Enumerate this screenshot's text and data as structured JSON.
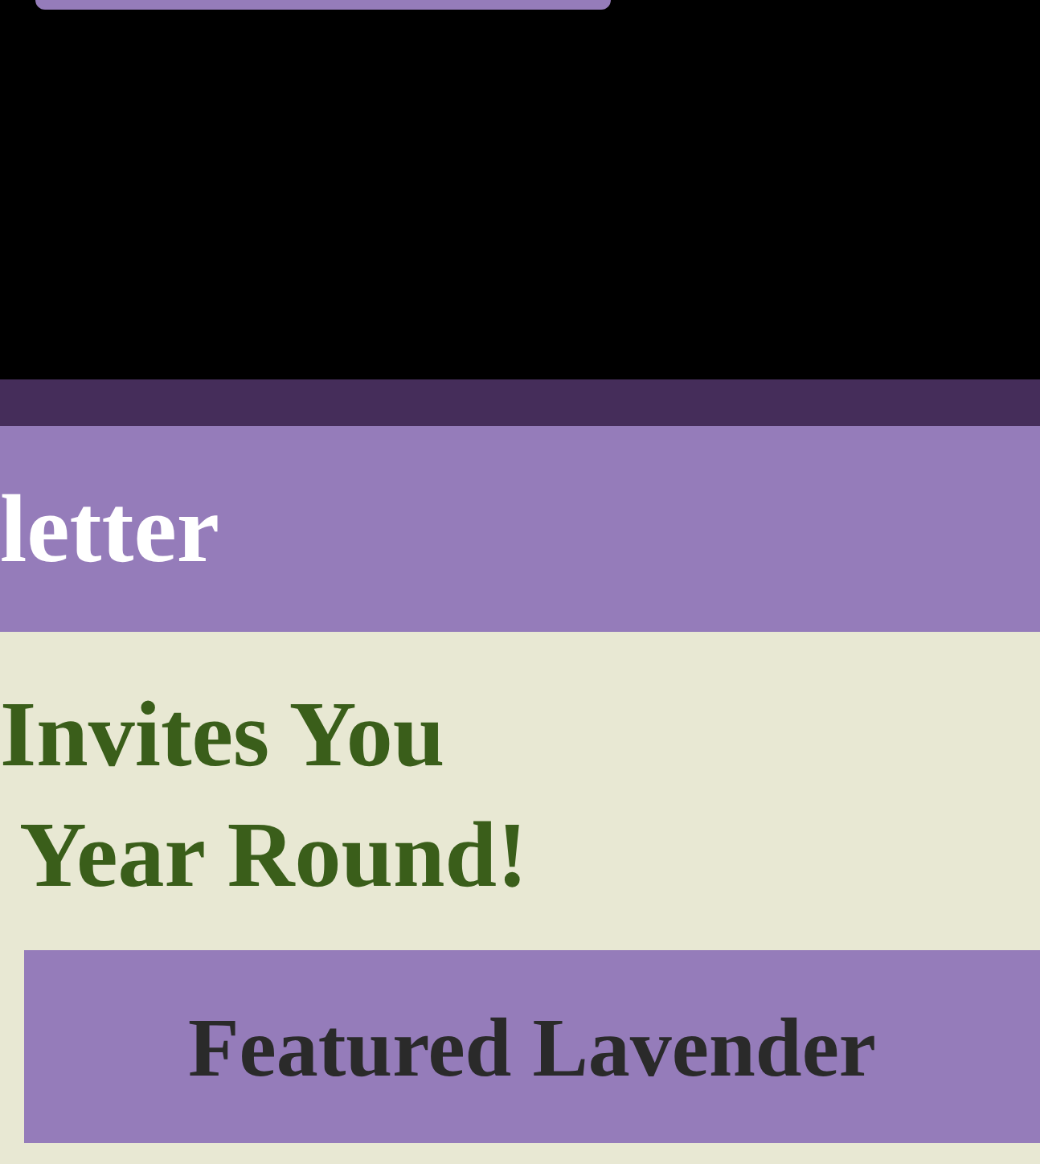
{
  "banner": {
    "title": "letter"
  },
  "hero": {
    "lines": [
      "Invites You",
      "Year Round!"
    ]
  },
  "featured": {
    "title": "Featured Lavender"
  }
}
